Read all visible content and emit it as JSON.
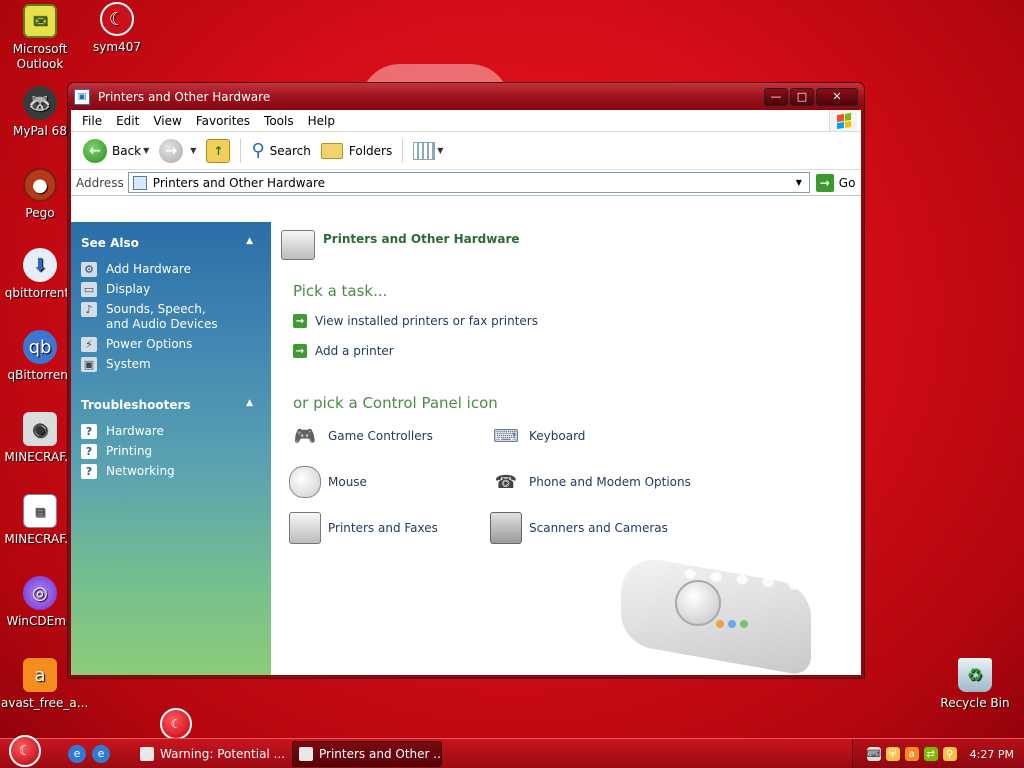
{
  "desktop": {
    "icons_left": [
      {
        "label": "Microsoft Outlook",
        "icon": "outlook-icon"
      },
      {
        "label": "MyPal 68",
        "icon": "raccoon-icon"
      },
      {
        "label": "Pego",
        "icon": "pego-icon"
      },
      {
        "label": "qbittorrent_",
        "icon": "qbittorrent-installer-icon"
      },
      {
        "label": "qBittorrent",
        "icon": "qbittorrent-icon"
      },
      {
        "label": "MINECRAF...",
        "icon": "cd-icon"
      },
      {
        "label": "MINECRAF...",
        "icon": "document-icon"
      },
      {
        "label": "WinCDEmu",
        "icon": "wincdemu-icon"
      },
      {
        "label": "avast_free_a...",
        "icon": "avast-icon"
      }
    ],
    "icon_top": {
      "label": "sym407",
      "icon": "crescent-star-icon"
    },
    "recycle_bin": {
      "label": "Recycle Bin",
      "icon": "recycle-bin-icon"
    }
  },
  "window": {
    "title": "Printers and Other Hardware",
    "buttons": {
      "minimize": "—",
      "maximize": "□",
      "close": "✕"
    },
    "menu": [
      "File",
      "Edit",
      "View",
      "Favorites",
      "Tools",
      "Help"
    ],
    "toolbar": {
      "back": "Back",
      "search": "Search",
      "folders": "Folders"
    },
    "address": {
      "label": "Address",
      "value": "Printers and Other Hardware",
      "go": "Go"
    }
  },
  "left_pane": {
    "see_also": {
      "title": "See Also",
      "items": [
        "Add Hardware",
        "Display",
        "Sounds, Speech, and Audio Devices",
        "Power Options",
        "System"
      ]
    },
    "troubleshooters": {
      "title": "Troubleshooters",
      "items": [
        "Hardware",
        "Printing",
        "Networking"
      ]
    }
  },
  "main": {
    "header": "Printers and Other Hardware",
    "pick_task": "Pick a task...",
    "tasks": [
      "View installed printers or fax printers",
      "Add a printer"
    ],
    "pick_icon": "or pick a Control Panel icon",
    "icons": [
      "Game Controllers",
      "Keyboard",
      "Mouse",
      "Phone and Modem Options",
      "Printers and Faxes",
      "Scanners and Cameras"
    ]
  },
  "taskbar": {
    "tasks": [
      "Warning: Potential ...",
      "Printers and Other ..."
    ],
    "clock": "4:27 PM"
  },
  "colors": {
    "desktop": "#d40d18",
    "accent_green": "#2a6b35",
    "panel_blue": "#2a6ea8"
  }
}
